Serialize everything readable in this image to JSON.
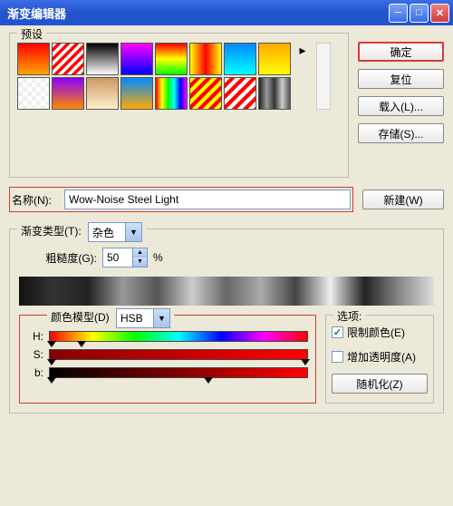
{
  "window": {
    "title": "渐变编辑器"
  },
  "buttons": {
    "ok": "确定",
    "reset": "复位",
    "load": "载入(L)...",
    "save": "存储(S)...",
    "new": "新建(W)",
    "random": "随机化(Z)"
  },
  "presets": {
    "label": "预设"
  },
  "name": {
    "label": "名称(N):",
    "value": "Wow-Noise Steel Light"
  },
  "type": {
    "label": "渐变类型(T):",
    "value": "杂色",
    "roughness_label": "粗糙度(G):",
    "roughness_value": "50",
    "percent": "%"
  },
  "colormodel": {
    "label": "颜色模型(D)",
    "value": "HSB",
    "h": "H:",
    "s": "S:",
    "b": "b:"
  },
  "options": {
    "label": "选项:",
    "restrict": "限制颜色(E)",
    "restrict_checked": true,
    "transparency": "增加透明度(A)",
    "transparency_checked": false
  }
}
